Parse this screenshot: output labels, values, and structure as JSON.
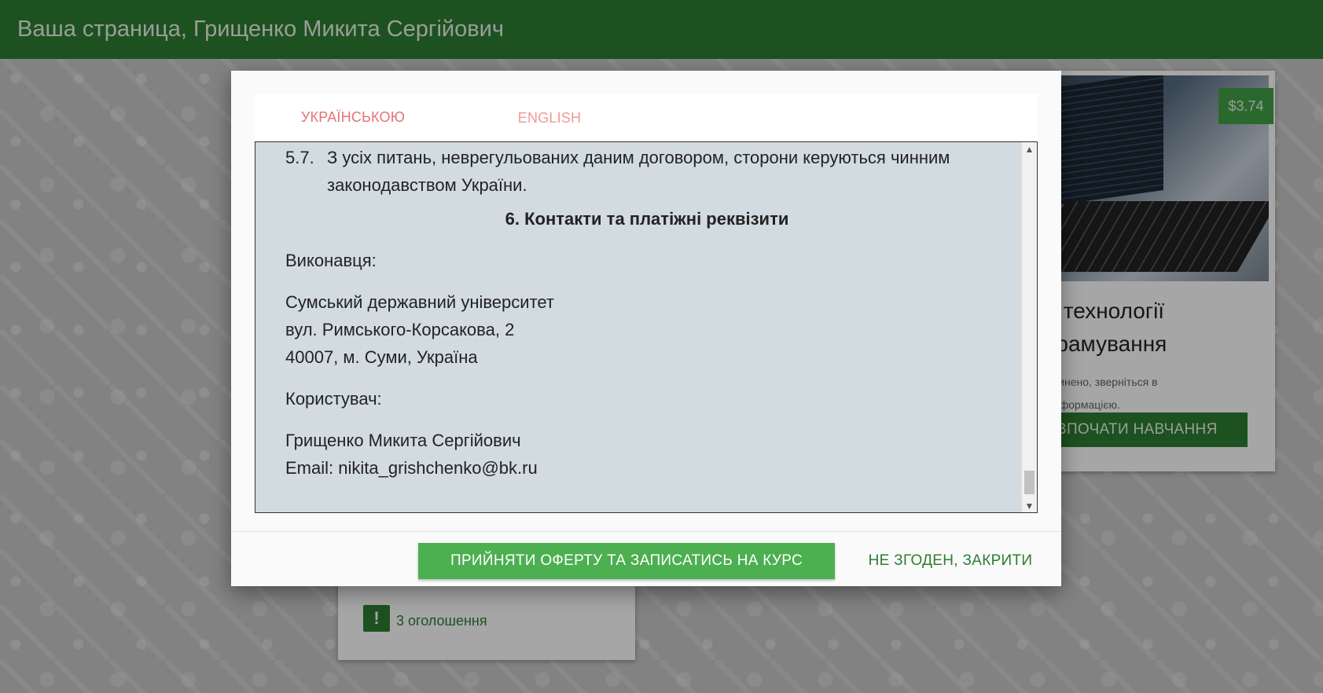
{
  "header": {
    "title": "Ваша страница, Грищенко Микита Сергійович"
  },
  "background": {
    "price": "$3.74",
    "course_title_line1": "оверні технології",
    "course_title_line2": "о-програмування",
    "course_note_line1": "класу призупинено, зверніться в",
    "course_note_line2": "детальною інформацією.",
    "start_button": "ВПОЧАТИ НАВЧАННЯ",
    "announcements": "3 оголошення",
    "announcement_icon": "!"
  },
  "modal": {
    "tabs": [
      {
        "label": "УКРАЇНСЬКОЮ"
      },
      {
        "label": "ENGLISH"
      }
    ],
    "clause_num": "5.7.",
    "clause_text": "З усіх питань, неврегульованих даним договором, сторони керуються чинним законодавством України.",
    "section_heading": "6. Контакти та платіжні реквізити",
    "executor_label": "Виконавця:",
    "executor_name": "Сумський державний університет",
    "executor_street": "вул. Римського-Корсакова, 2",
    "executor_city": "40007, м. Суми, Україна",
    "user_label": "Користувач:",
    "user_name": "Грищенко Микита Сергійович",
    "user_email": "Email: nikita_grishchenko@bk.ru",
    "accept_label": "ПРИЙНЯТИ ОФЕРТУ ТА ЗАПИСАТИСЬ НА КУРС",
    "decline_label": "НЕ ЗГОДЕН, ЗАКРИТИ"
  },
  "colors": {
    "header": "#2e7d32",
    "accent": "#4caf50",
    "tab_text": "#e57373",
    "content_bg": "#d2dbe0"
  }
}
